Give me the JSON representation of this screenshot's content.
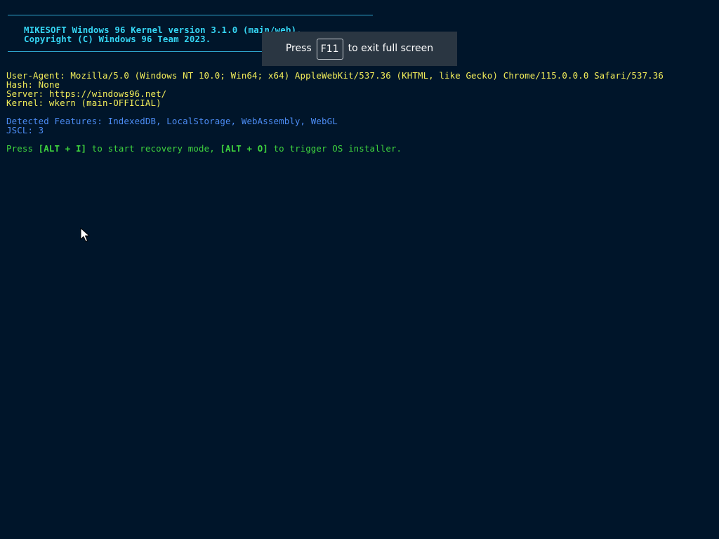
{
  "banner": {
    "line1": "MIKESOFT Windows 96 Kernel version 3.1.0 (main/web).",
    "line2": "Copyright (C) Windows 96 Team 2023."
  },
  "sysinfo": {
    "user_agent": "User-Agent: Mozilla/5.0 (Windows NT 10.0; Win64; x64) AppleWebKit/537.36 (KHTML, like Gecko) Chrome/115.0.0.0 Safari/537.36",
    "hash": "Hash: None",
    "server": "Server: https://windows96.net/",
    "kernel": "Kernel: wkern (main-OFFICIAL)"
  },
  "features": {
    "detected": "Detected Features: IndexedDB, LocalStorage, WebAssembly, WebGL",
    "jscl": "JSCL: 3"
  },
  "prompt": {
    "press": "Press ",
    "key1": "[ALT + I]",
    "mid": " to start recovery mode, ",
    "key2": "[ALT + O]",
    "end": " to trigger OS installer."
  },
  "fullscreen_toast": {
    "press": "Press",
    "key": "F11",
    "message": "to exit full screen"
  },
  "colors": {
    "background": "#00152a",
    "banner": "#35d6f4",
    "info": "#f2ee5a",
    "features": "#4c8df5",
    "prompt": "#3ed43e"
  }
}
